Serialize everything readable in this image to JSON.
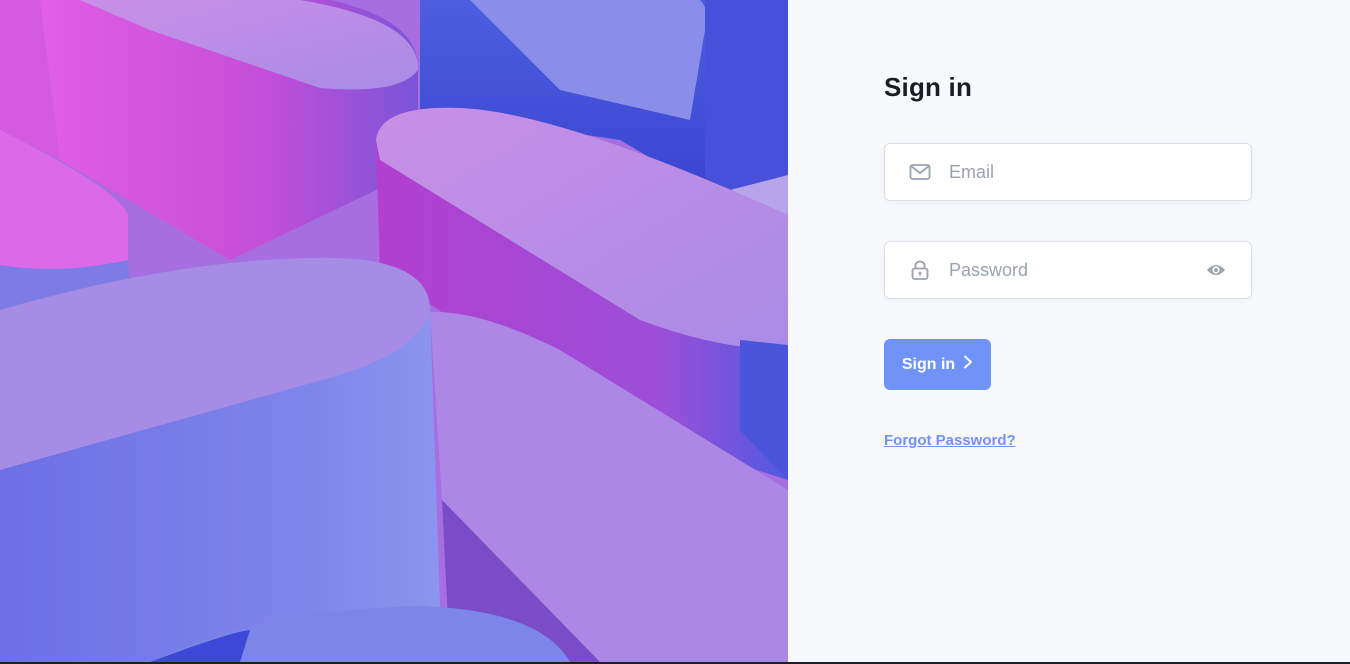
{
  "colors": {
    "accent": "#6f93f7",
    "panel_background": "#f7f9fd",
    "title_text": "#1c1d24",
    "placeholder_text": "#9aa2b2",
    "icon": "#9aa2b2"
  },
  "hero": {
    "image_name": "abstract-3d-purple-shapes"
  },
  "form": {
    "title": "Sign in",
    "email": {
      "placeholder": "Email",
      "value": "",
      "icon": "mail-icon"
    },
    "password": {
      "placeholder": "Password",
      "value": "",
      "icon": "lock-icon",
      "toggle_icon": "eye-icon"
    },
    "submit_label": "Sign in",
    "submit_icon": "chevron-right-icon",
    "forgot_label": "Forgot Password?"
  }
}
